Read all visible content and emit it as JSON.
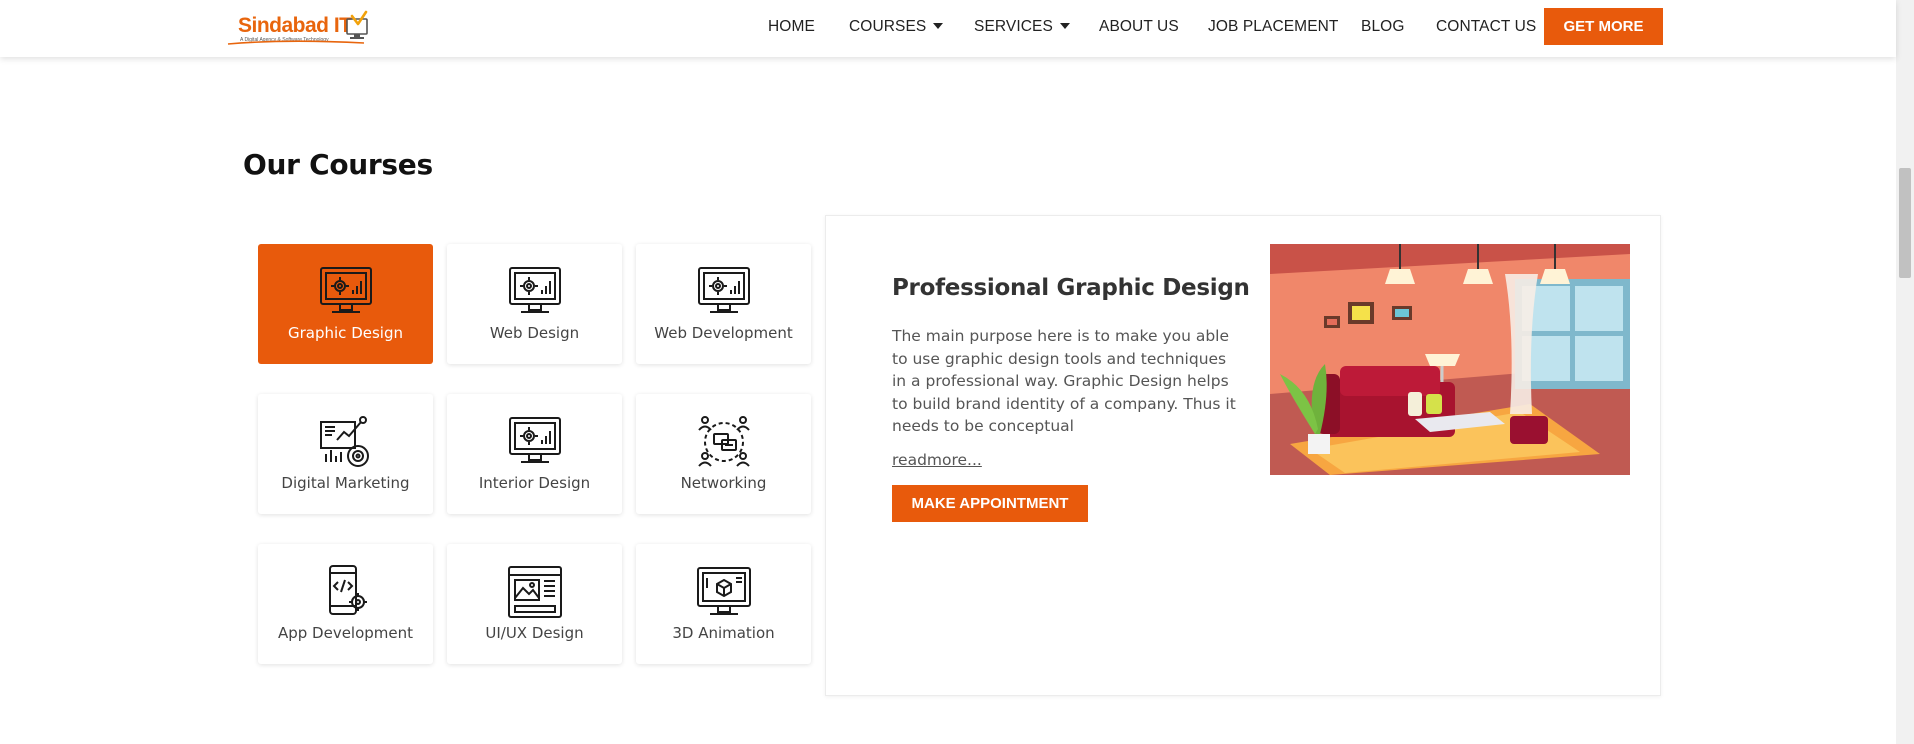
{
  "brand": {
    "name": "Sindabad IT",
    "tagline": "A Digital Agency & Software Technology"
  },
  "colors": {
    "accent": "#e85a0c",
    "text": "#222222",
    "muted": "#555555"
  },
  "nav": {
    "items": [
      {
        "label": "HOME",
        "has_dropdown": false
      },
      {
        "label": "COURSES",
        "has_dropdown": true
      },
      {
        "label": "SERVICES",
        "has_dropdown": true
      },
      {
        "label": "ABOUT US",
        "has_dropdown": false
      },
      {
        "label": "JOB PLACEMENT",
        "has_dropdown": false
      },
      {
        "label": "BLOG",
        "has_dropdown": false
      },
      {
        "label": "CONTACT US",
        "has_dropdown": false
      }
    ],
    "cta_label": "GET MORE"
  },
  "section": {
    "title": "Our Courses"
  },
  "courses": [
    {
      "label": "Graphic Design",
      "icon": "monitor-gear-chart-icon",
      "active": true
    },
    {
      "label": "Web Design",
      "icon": "monitor-gear-chart-icon",
      "active": false
    },
    {
      "label": "Web Development",
      "icon": "monitor-gear-chart-icon",
      "active": false
    },
    {
      "label": "Digital Marketing",
      "icon": "marketing-analytics-icon",
      "active": false
    },
    {
      "label": "Interior Design",
      "icon": "monitor-gear-chart-icon",
      "active": false
    },
    {
      "label": "Networking",
      "icon": "network-people-icon",
      "active": false
    },
    {
      "label": "App Development",
      "icon": "mobile-code-gear-icon",
      "active": false
    },
    {
      "label": "UI/UX Design",
      "icon": "wireframe-layout-icon",
      "active": false
    },
    {
      "label": "3D Animation",
      "icon": "monitor-3d-cube-icon",
      "active": false
    }
  ],
  "detail": {
    "title": "Professional Graphic Design",
    "description": "The main purpose here is to make you able to use graphic design tools and techniques in a professional way. Graphic Design helps to build brand identity of a company. Thus it needs to be conceptual",
    "readmore_label": "readmore...",
    "button_label": "MAKE APPOINTMENT",
    "image_icon": "living-room-illustration"
  }
}
